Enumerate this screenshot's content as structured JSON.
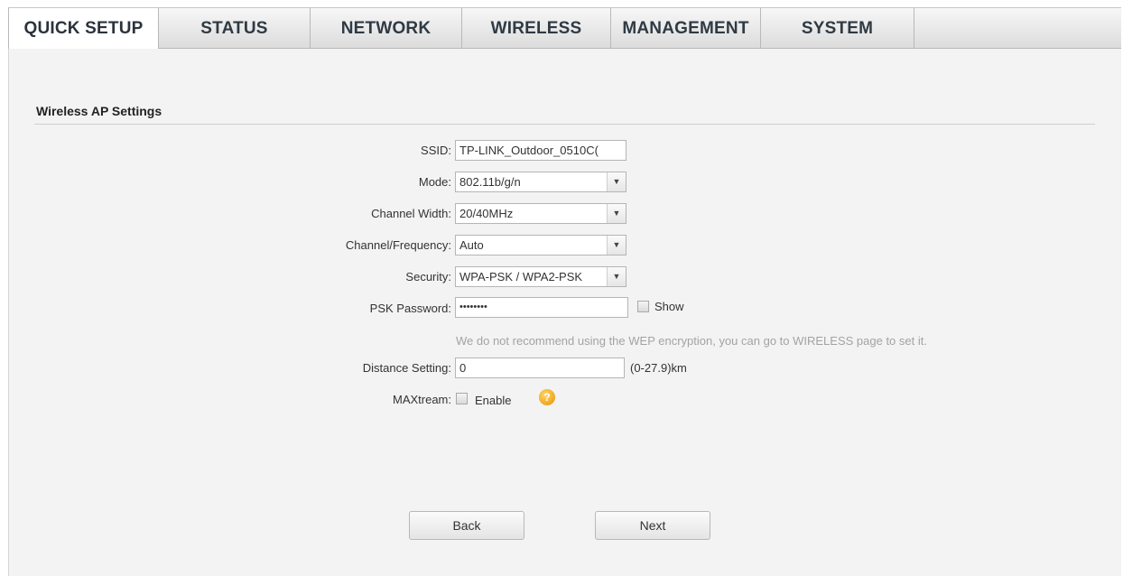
{
  "nav": {
    "tabs": [
      {
        "label": "QUICK SETUP",
        "active": true
      },
      {
        "label": "STATUS",
        "active": false
      },
      {
        "label": "NETWORK",
        "active": false
      },
      {
        "label": "WIRELESS",
        "active": false
      },
      {
        "label": "MANAGEMENT",
        "active": false
      },
      {
        "label": "SYSTEM",
        "active": false
      }
    ]
  },
  "section": {
    "title": "Wireless AP Settings"
  },
  "form": {
    "ssid": {
      "label": "SSID:",
      "value": "TP-LINK_Outdoor_0510C("
    },
    "mode": {
      "label": "Mode:",
      "value": "802.11b/g/n"
    },
    "channel_width": {
      "label": "Channel Width:",
      "value": "20/40MHz"
    },
    "channel_frequency": {
      "label": "Channel/Frequency:",
      "value": "Auto"
    },
    "security": {
      "label": "Security:",
      "value": "WPA-PSK / WPA2-PSK"
    },
    "psk_password": {
      "label": "PSK Password:",
      "value": "••••••••",
      "show_label": "Show",
      "show_checked": false
    },
    "hint": "We do not recommend using the WEP encryption, you can go to WIRELESS page to set it.",
    "distance": {
      "label": "Distance Setting:",
      "value": "0",
      "range": "(0-27.9)km"
    },
    "maxtream": {
      "label": "MAXtream:",
      "enable_label": "Enable",
      "checked": false,
      "help_glyph": "?"
    }
  },
  "buttons": {
    "back": "Back",
    "next": "Next"
  },
  "colors": {
    "panel_bg": "#f3f3f3",
    "help_icon": "#f0a51c",
    "hint_text": "#a3a3a3"
  }
}
